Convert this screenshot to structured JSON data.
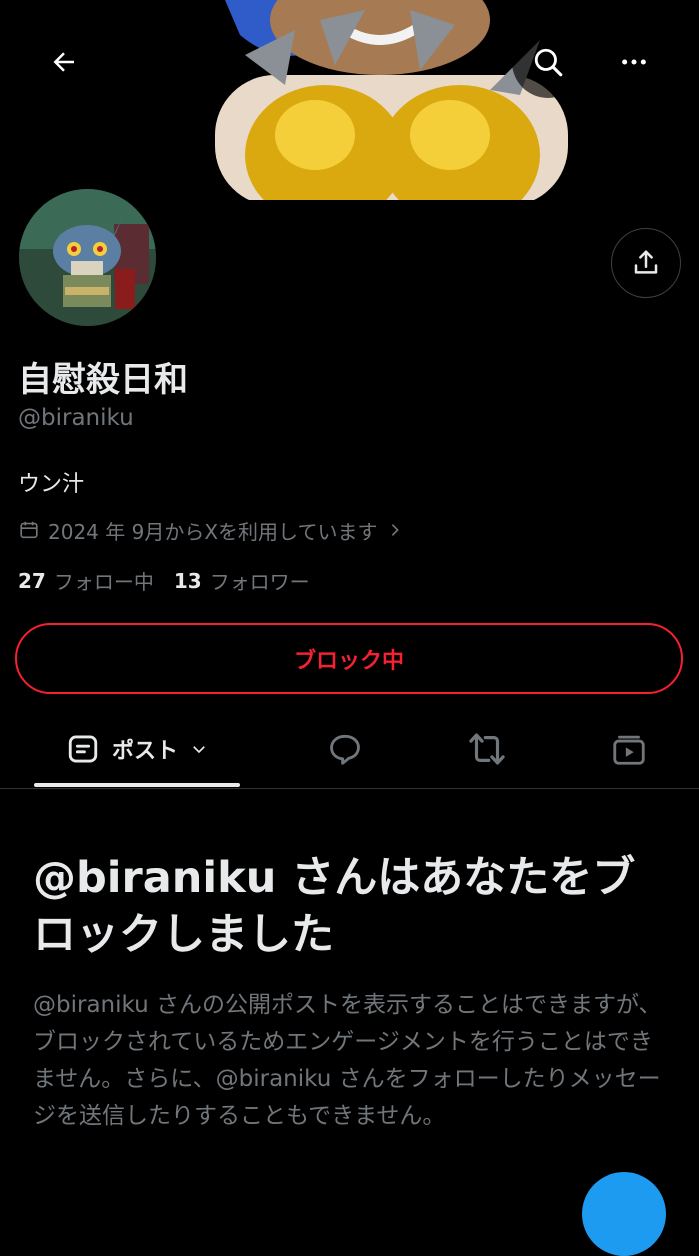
{
  "profile": {
    "display_name": "自慰殺日和",
    "handle": "@biraniku",
    "bio": "ウン汁",
    "joined": "2024 年 9月からXを利用しています",
    "following_count": "27",
    "following_label": "フォロー中",
    "followers_count": "13",
    "followers_label": "フォロワー",
    "blocked_button": "ブロック中"
  },
  "tabs": {
    "posts_label": "ポスト"
  },
  "blocked_notice": {
    "title": "@biraniku さんはあなたをブロックしました",
    "description": "@biraniku さんの公開ポストを表示することはできますが、ブロックされているためエンゲージメントを行うことはできません。さらに、@biraniku さんをフォローしたりメッセージを送信したりすることもできません。"
  },
  "icons": [
    "back-arrow-icon",
    "search-icon",
    "more-icon",
    "share-icon",
    "calendar-icon",
    "chevron-right-icon",
    "posts-icon",
    "chevron-down-icon",
    "reply-icon",
    "repost-icon",
    "media-icon"
  ],
  "colors": {
    "background": "#000000",
    "primary_text": "#e7e9ea",
    "secondary_text": "#71767b",
    "block_red": "#f4212e",
    "accent_blue": "#1d9bf0",
    "divider": "#2f3336"
  }
}
